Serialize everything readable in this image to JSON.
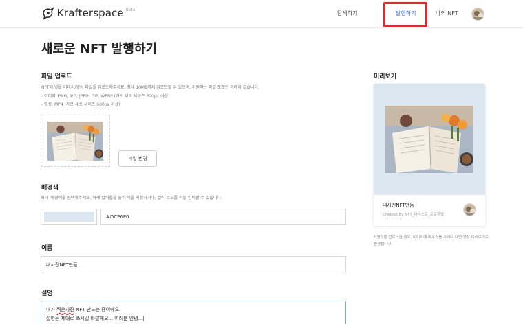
{
  "header": {
    "logo_text": "Krafterspace",
    "logo_badge": "Beta",
    "nav": {
      "explore": "탐색하기",
      "mint": "발행하기",
      "my_nft": "나의 NFT"
    }
  },
  "page": {
    "title": "새로운 NFT 발행하기"
  },
  "upload": {
    "title": "파일 업로드",
    "desc_lines": [
      "NFT에 넣을 이미지/영상 파일을 업로드해주세요. 최대 10MB까지 업로드할 수 있으며, 지원하는 파일 포맷은 아래와 같습니다.",
      "- 이미지: PNG, JPG, JPEG, GIF, WEBP (가로 세로 사이즈 600px 이상)",
      "- 영상: MP4 (가로 세로 사이즈 600px 이상)"
    ],
    "change_button": "파일 변경"
  },
  "background": {
    "title": "배경색",
    "desc": "NFT 배경색을 선택해주세요. 아래 컬러칩을 눌러 색을 지정하거나, 컬러 코드를 직접 입력할 수 있습니다.",
    "color_value": "#DCE6F0"
  },
  "name": {
    "title": "이름",
    "value": "내사진NFT만듬"
  },
  "description": {
    "title": "설명",
    "line1_prefix": "내가 ",
    "line1_underlined": "찍은사진",
    "line1_suffix": " NFT 만드는 중이에요.",
    "line2": "설명은 제대로 쓰시길 바랄게요... 여러분 안녕...|"
  },
  "preview": {
    "title": "미리보기",
    "nft_name": "내사진NFT만듬",
    "creator": "Created By NFT_아티스트_프로히엘",
    "note": "* 영상을 업로드한 경우, 이미지에 마우스를 가져다 대면 영상 미리보기로 변경됩니다."
  },
  "colors": {
    "accent": "#3b6cf0",
    "highlight": "#e8262a",
    "preview_bg": "#DCE6F0"
  }
}
